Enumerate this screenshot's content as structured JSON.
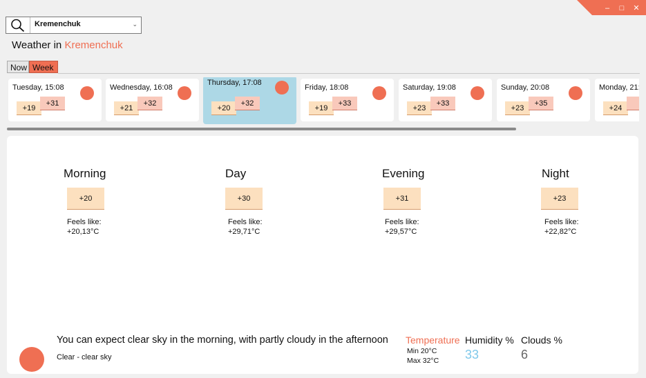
{
  "window": {
    "accent_color": "#ef6f53",
    "minimize_icon": "minimize-icon",
    "maximize_icon": "maximize-icon",
    "close_icon": "close-icon"
  },
  "search": {
    "icon": "search-icon",
    "city": "Kremenchuk"
  },
  "header": {
    "prefix": "Weather in",
    "city": "Kremenchuk"
  },
  "tabs": {
    "now": "Now",
    "week": "Week",
    "active": "Week"
  },
  "days": [
    {
      "title": "Tuesday, 15:08",
      "min": "+19",
      "max": "+31",
      "icon": "clear-sky-icon"
    },
    {
      "title": "Wednesday, 16:08",
      "min": "+21",
      "max": "+32",
      "icon": "clear-sky-icon"
    },
    {
      "title": "Thursday, 17:08",
      "min": "+20",
      "max": "+32",
      "icon": "clear-sky-icon",
      "selected": true
    },
    {
      "title": "Friday, 18:08",
      "min": "+19",
      "max": "+33",
      "icon": "clear-sky-icon"
    },
    {
      "title": "Saturday, 19:08",
      "min": "+23",
      "max": "+33",
      "icon": "clear-sky-icon"
    },
    {
      "title": "Sunday, 20:08",
      "min": "+23",
      "max": "+35",
      "icon": "clear-sky-icon"
    },
    {
      "title": "Monday, 21:",
      "min": "+24",
      "max": "",
      "icon": "clear-sky-icon"
    }
  ],
  "periods": [
    {
      "name": "Morning",
      "temp": "+20",
      "feels_label": "Feels like:",
      "feels": "+20,13°C"
    },
    {
      "name": "Day",
      "temp": "+30",
      "feels_label": "Feels like:",
      "feels": "+29,71°C"
    },
    {
      "name": "Evening",
      "temp": "+31",
      "feels_label": "Feels like:",
      "feels": "+29,57°C"
    },
    {
      "name": "Night",
      "temp": "+23",
      "feels_label": "Feels like:",
      "feels": "+22,82°C"
    }
  ],
  "summary": {
    "icon": "clear-sky-icon",
    "text": "You can expect clear sky in the morning, with partly cloudy in the afternoon",
    "condition": "Clear - clear sky"
  },
  "stats": {
    "temperature_label": "Temperature",
    "min": "Min 20°C",
    "max": "Max 32°C",
    "humidity_label": "Humidity %",
    "humidity": "33",
    "clouds_label": "Clouds %",
    "clouds": "6"
  }
}
